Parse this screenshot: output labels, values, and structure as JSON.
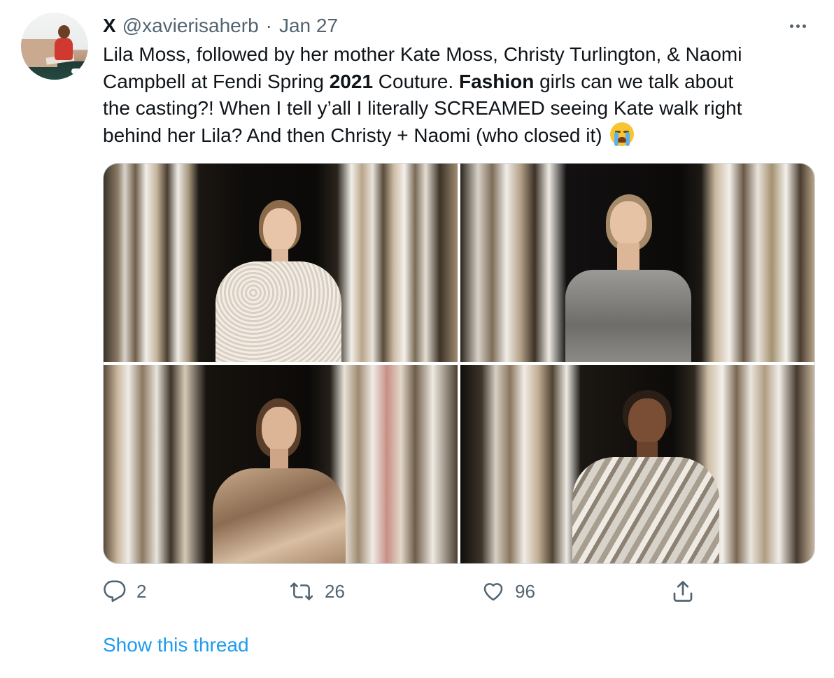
{
  "author": {
    "name": "X",
    "handle": "@xavierisaherb",
    "separator": "·",
    "date": "Jan 27"
  },
  "tweet": {
    "text_line1": "Lila Moss, followed by her mother Kate Moss, Christy Turlington, & Naomi",
    "text_line2_pre": "Campbell at Fendi Spring ",
    "text_line2_bold1": "2021",
    "text_line2_mid": " Couture. ",
    "text_line2_bold2": "Fashion",
    "text_line2_post": " girls can we talk about",
    "text_line3": "the casting?! When I tell y’all I literally SCREAMED seeing Kate walk right",
    "text_line4": "behind her Lila? And then Christy + Naomi (who closed it)",
    "emoji": "loudly-crying-face"
  },
  "media": {
    "photos": [
      "photo-1",
      "photo-2",
      "photo-3",
      "photo-4"
    ]
  },
  "actions": {
    "replies": "2",
    "retweets": "26",
    "likes": "96",
    "reply_icon": "reply-icon",
    "retweet_icon": "retweet-icon",
    "like_icon": "heart-icon",
    "share_icon": "share-icon",
    "icon_color": "#536471"
  },
  "thread_link": "Show this thread",
  "colors": {
    "link": "#1d9bf0",
    "secondary_text": "#536471",
    "primary_text": "#0f1419",
    "border": "#cfd9de"
  }
}
